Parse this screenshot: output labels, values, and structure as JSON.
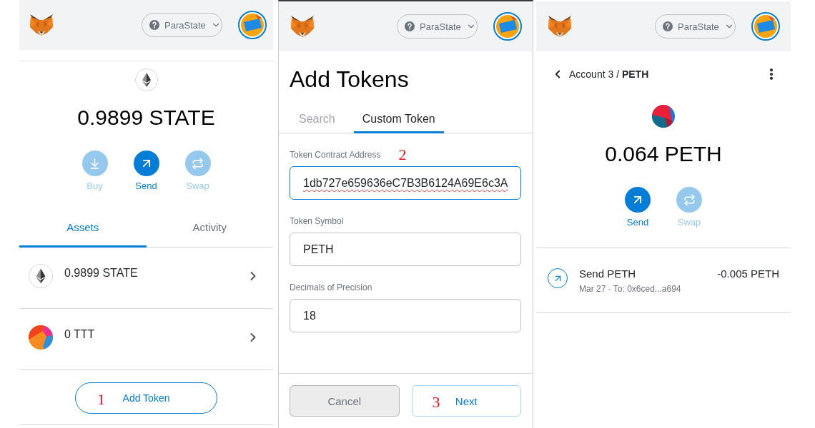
{
  "panels": [
    {
      "kind": "wallet",
      "header": {
        "network": "ParaState"
      },
      "balance": "0.9899 STATE",
      "actions": [
        {
          "kind": "buy",
          "label": "Buy",
          "disabled": true
        },
        {
          "kind": "send",
          "label": "Send",
          "disabled": false
        },
        {
          "kind": "swap",
          "label": "Swap",
          "disabled": true
        }
      ],
      "tabs": [
        {
          "label": "Assets",
          "selected": true
        },
        {
          "label": "Activity",
          "selected": false
        }
      ],
      "assets": [
        {
          "kind": "native",
          "amount": "0.9899 STATE"
        },
        {
          "kind": "token",
          "amount": "0 TTT"
        }
      ],
      "add_token": {
        "label": "Add Token",
        "step": "1"
      }
    },
    {
      "kind": "add_tokens",
      "header": {
        "network": "ParaState"
      },
      "title": "Add Tokens",
      "tabs": [
        {
          "label": "Search",
          "selected": false
        },
        {
          "label": "Custom Token",
          "selected": true
        }
      ],
      "fields": [
        {
          "label": "Token Contract Address",
          "value": "1db727e659636eC7B3B6124A69E6c3A",
          "focused": true,
          "spelling_flagged": true,
          "step": "2"
        },
        {
          "label": "Token Symbol",
          "value": "PETH",
          "focused": false,
          "spelling_flagged": false
        },
        {
          "label": "Decimals of Precision",
          "value": "18",
          "focused": false,
          "spelling_flagged": false
        }
      ],
      "buttons": [
        {
          "kind": "secondary",
          "label": "Cancel"
        },
        {
          "kind": "primary",
          "label": "Next",
          "step": "3"
        }
      ]
    },
    {
      "kind": "token_detail",
      "header": {
        "network": "ParaState"
      },
      "breadcrumb": "Account 3 / **PETH**",
      "balance": "0.064 PETH",
      "actions": [
        {
          "kind": "send",
          "label": "Send",
          "disabled": false
        },
        {
          "kind": "swap",
          "label": "Swap",
          "disabled": true
        }
      ],
      "transactions": [
        {
          "title": "Send PETH",
          "details": "Mar 27 · To: 0x6ced...a694",
          "amount": "-0.005 PETH"
        }
      ]
    }
  ]
}
